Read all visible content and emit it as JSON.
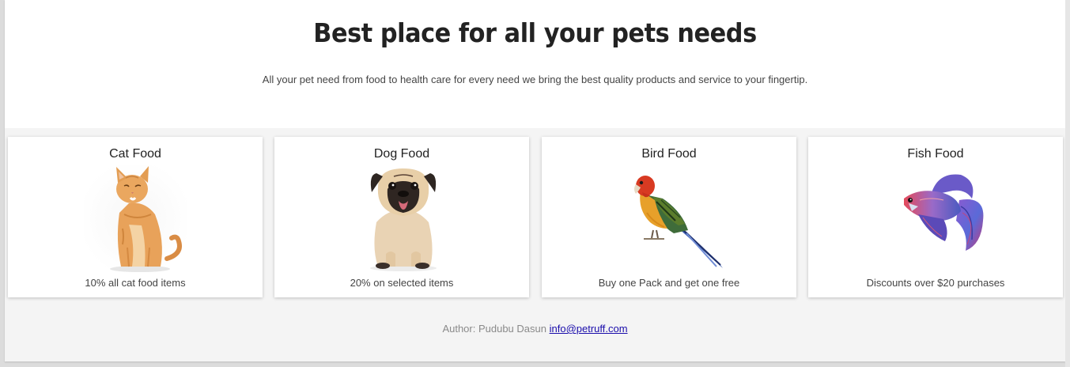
{
  "hero": {
    "title": "Best place for all your pets needs",
    "subtitle": "All your pet need from food to health care for every need we bring the best quality products and service to your fingertip."
  },
  "cards": [
    {
      "title": "Cat Food",
      "description": "10% all cat food items",
      "image": "cat-image"
    },
    {
      "title": "Dog Food",
      "description": "20% on selected items",
      "image": "dog-image"
    },
    {
      "title": "Bird Food",
      "description": "Buy one Pack and get one free",
      "image": "parrot-image"
    },
    {
      "title": "Fish Food",
      "description": "Discounts over $20 purchases",
      "image": "betta-fish-image"
    }
  ],
  "footer": {
    "author_text": "Author: Pudubu Dasun",
    "email": "info@petruff.com"
  },
  "colors": {
    "heading": "#222222",
    "text": "#444444",
    "footer_text": "#8a8a8a",
    "link": "#1a0dab",
    "footer_bg": "#f4f4f4"
  }
}
